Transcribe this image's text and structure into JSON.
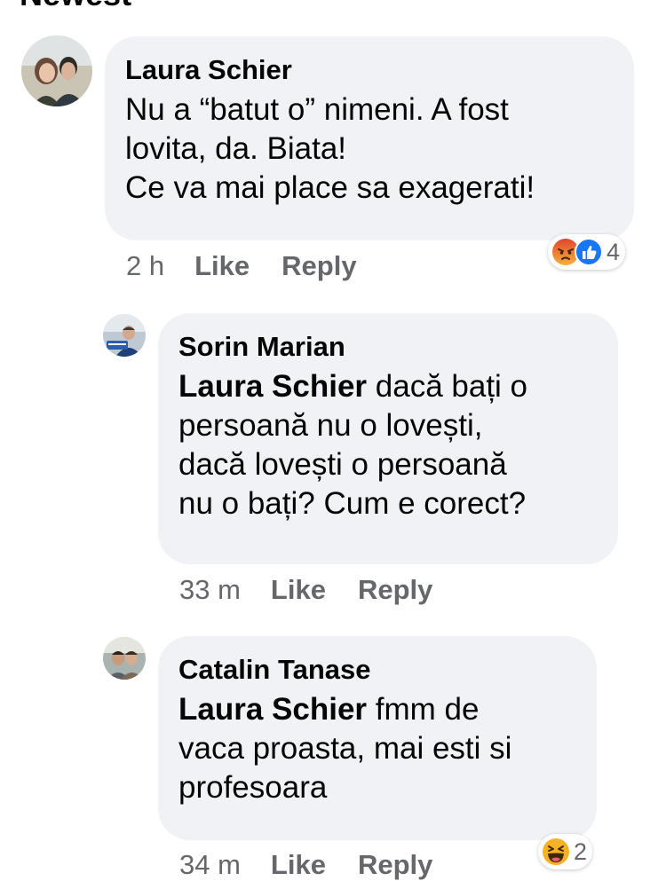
{
  "header": {
    "title": "Newest"
  },
  "comments": [
    {
      "author": "Laura Schier",
      "lines": [
        "Nu a “batut o” nimeni. A fost",
        "lovita, da. Biata!",
        "Ce va mai place sa exagerati!"
      ],
      "time": "2 h",
      "like": "Like",
      "reply": "Reply",
      "reactions": {
        "icons": [
          "angry-icon",
          "like-icon"
        ],
        "count": "4"
      }
    },
    {
      "author": "Sorin Marian",
      "mention": "Laura Schier",
      "lines": [
        " dacă bați o",
        "persoană nu o lovești,",
        "dacă lovești o persoană",
        "nu o bați? Cum e corect?"
      ],
      "time": "33 m",
      "like": "Like",
      "reply": "Reply"
    },
    {
      "author": "Catalin Tanase",
      "mention": "Laura Schier",
      "lines": [
        " fmm de",
        "vaca proasta, mai esti si",
        "profesoara"
      ],
      "time": "34 m",
      "like": "Like",
      "reply": "Reply",
      "reactions": {
        "icons": [
          "haha-icon"
        ],
        "count": "2"
      }
    }
  ],
  "colors": {
    "bubble": "#f0f2f5",
    "meta": "#65676b",
    "like_blue": "#1877f2",
    "angry": "#e9710f",
    "haha": "#f7b125"
  }
}
